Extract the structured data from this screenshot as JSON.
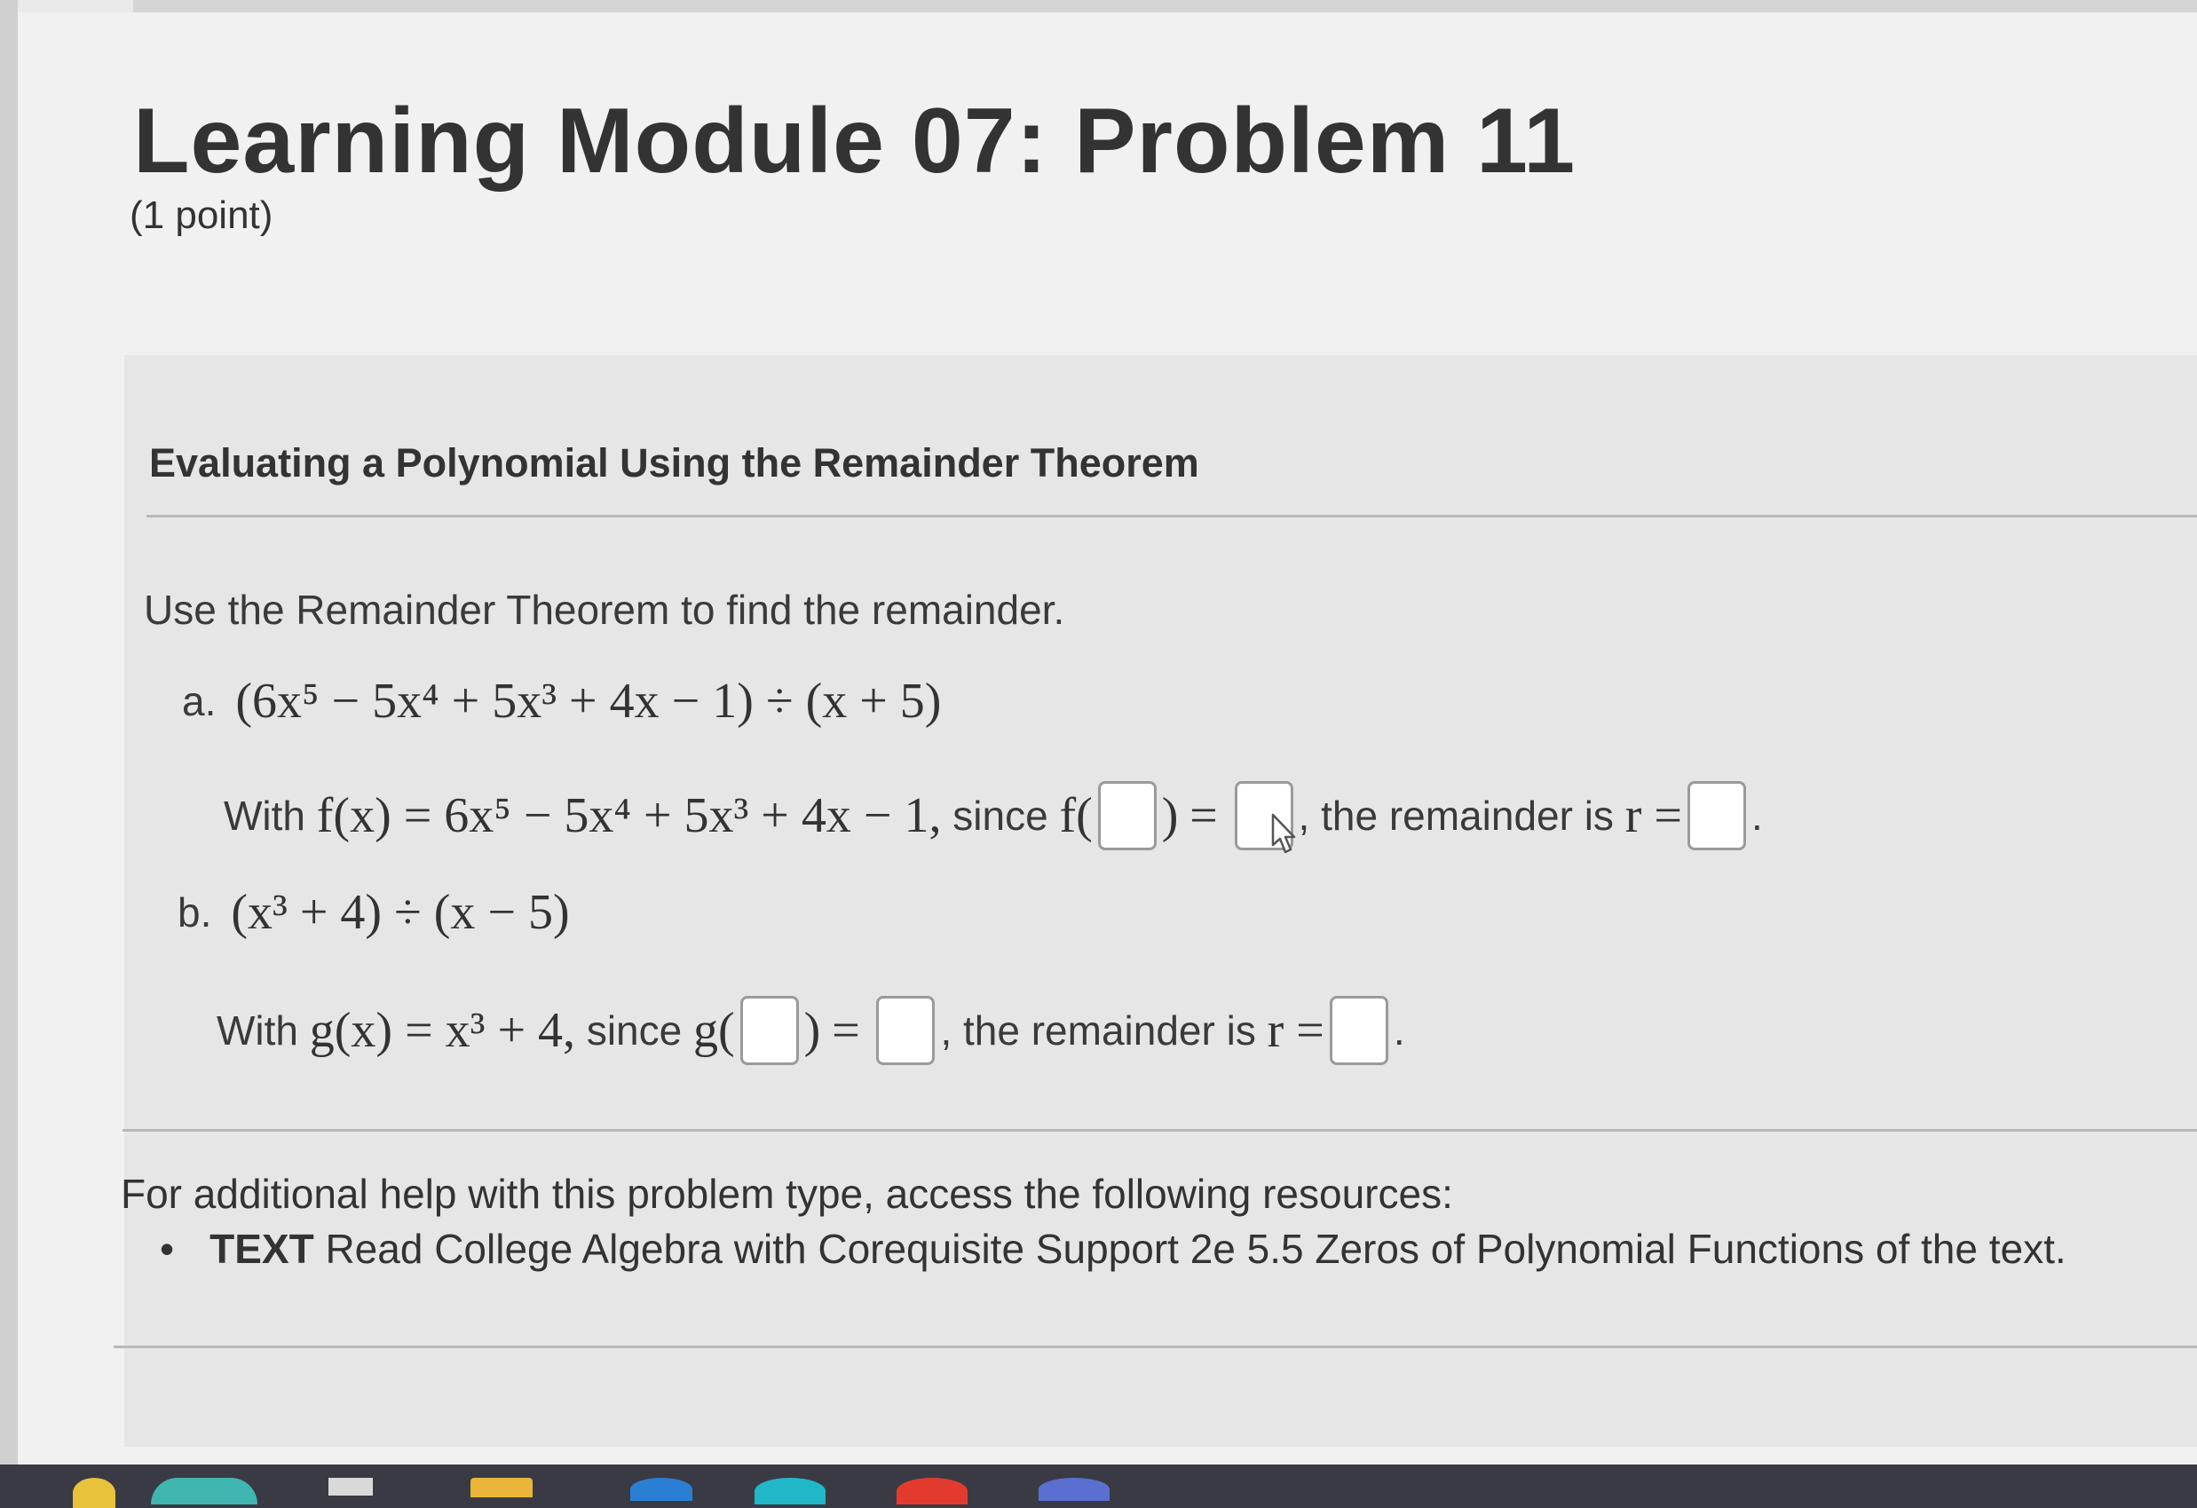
{
  "page": {
    "title": "Learning Module 07: Problem 11",
    "points": "(1 point)"
  },
  "problem": {
    "heading": "Evaluating a Polynomial Using the Remainder Theorem",
    "instruction": "Use the Remainder Theorem to find the remainder.",
    "part_a": {
      "label": "a.",
      "expression": "(6x⁵ − 5x⁴ + 5x³ + 4x − 1) ÷ (x + 5)",
      "with_text": "With",
      "function_def": "f(x) = 6x⁵ − 5x⁴ + 5x³ + 4x − 1,",
      "since_text": "since",
      "fn_open": "f(",
      "fn_close": ")",
      "equals": "=",
      "remainder_text": ", the remainder is",
      "r_symbol": "r =",
      "period": "."
    },
    "part_b": {
      "label": "b.",
      "expression": "(x³ + 4) ÷ (x − 5)",
      "with_text": "With",
      "function_def": "g(x) = x³ + 4,",
      "since_text": "since",
      "fn_open": "g(",
      "fn_close": ")",
      "equals": "=",
      "remainder_text": ", the remainder is",
      "r_symbol": "r =",
      "period": "."
    }
  },
  "help": {
    "intro": "For additional help with this problem type, access the following resources:",
    "bullet": "•",
    "resource_type": "TEXT",
    "resource_text": "Read College Algebra with Corequisite Support 2e 5.5 Zeros of Polynomial Functions of the text."
  },
  "icons": [
    "mouse-cursor-icon"
  ],
  "colors": {
    "page_bg": "#f1f1f1",
    "panel_bg": "#e6e6e6",
    "input_bg": "#ffffff",
    "input_border": "#9a9a9a"
  }
}
